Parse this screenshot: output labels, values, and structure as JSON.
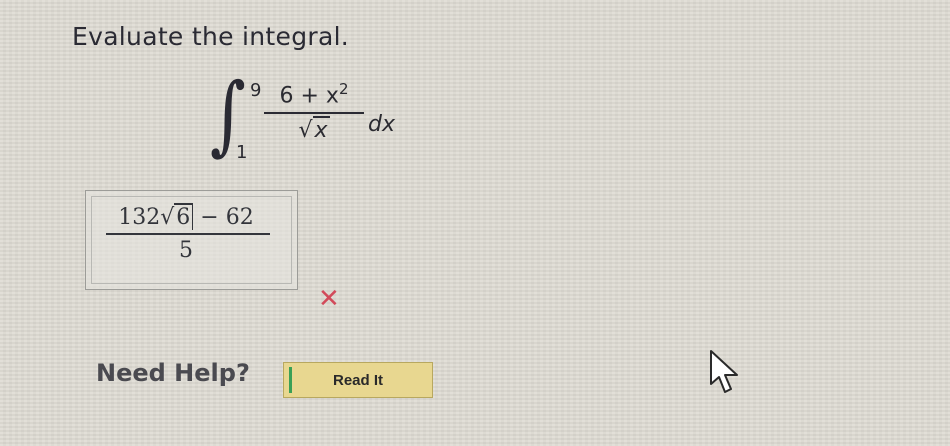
{
  "prompt": "Evaluate the integral.",
  "integral": {
    "upper_limit": "9",
    "lower_limit": "1",
    "numerator": "6 + x",
    "numerator_exponent": "2",
    "denominator_radical": "√",
    "denominator_arg": "x",
    "differential": "dx"
  },
  "answer": {
    "numerator_coef": "132",
    "radical": "√",
    "radical_arg": "6",
    "numerator_tail": " − 62",
    "denominator": "5",
    "status": "incorrect"
  },
  "icons": {
    "wrong": "✕",
    "cursor": "arrow-cursor-icon"
  },
  "colors": {
    "wrong": "#d24a5a",
    "button_bg": "#e8d790"
  },
  "help": {
    "label": "Need Help?",
    "read_it_label": "Read It"
  }
}
